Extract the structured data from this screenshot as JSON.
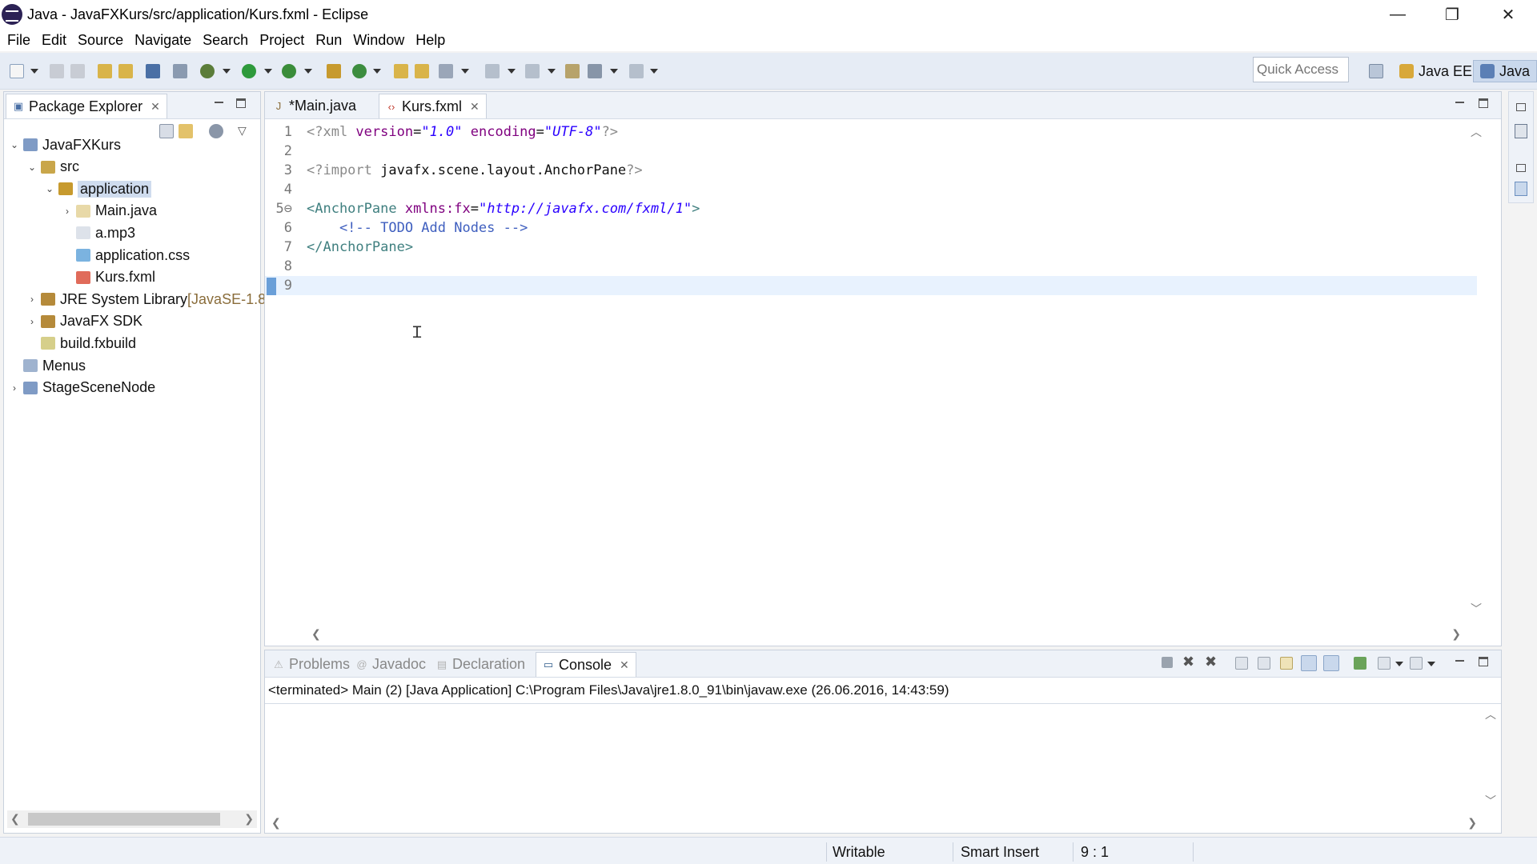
{
  "window": {
    "title": "Java - JavaFXKurs/src/application/Kurs.fxml - Eclipse",
    "minimize": "—",
    "restore": "❐",
    "close": "✕"
  },
  "menu": [
    "File",
    "Edit",
    "Source",
    "Navigate",
    "Search",
    "Project",
    "Run",
    "Window",
    "Help"
  ],
  "toolbar": {
    "quick_access_placeholder": "Quick Access",
    "perspectives": [
      "Java EE",
      "Java"
    ]
  },
  "package_explorer": {
    "title": "Package Explorer",
    "tree": [
      {
        "label": "JavaFXKurs",
        "depth": 0,
        "arrow": "open",
        "icon": "project-icon"
      },
      {
        "label": "src",
        "depth": 1,
        "arrow": "open",
        "icon": "source-folder-icon"
      },
      {
        "label": "application",
        "depth": 2,
        "arrow": "open",
        "icon": "package-icon",
        "selected": true
      },
      {
        "label": "Main.java",
        "depth": 3,
        "arrow": "closed",
        "icon": "java-file-icon"
      },
      {
        "label": "a.mp3",
        "depth": 3,
        "arrow": "none",
        "icon": "file-icon"
      },
      {
        "label": "application.css",
        "depth": 3,
        "arrow": "none",
        "icon": "css-file-icon"
      },
      {
        "label": "Kurs.fxml",
        "depth": 3,
        "arrow": "none",
        "icon": "fxml-file-icon"
      },
      {
        "label": "JRE System Library",
        "suffix": " [JavaSE-1.8",
        "depth": 1,
        "arrow": "closed",
        "icon": "library-icon"
      },
      {
        "label": "JavaFX SDK",
        "depth": 1,
        "arrow": "closed",
        "icon": "library-icon"
      },
      {
        "label": "build.fxbuild",
        "depth": 1,
        "arrow": "none",
        "icon": "build-file-icon"
      },
      {
        "label": "Menus",
        "depth": 0,
        "arrow": "none",
        "icon": "folder-icon"
      },
      {
        "label": "StageSceneNode",
        "depth": 0,
        "arrow": "closed",
        "icon": "project-icon"
      }
    ]
  },
  "editor": {
    "tabs": [
      {
        "label": "*Main.java",
        "active": false
      },
      {
        "label": "Kurs.fxml",
        "active": true
      }
    ],
    "lines": [
      {
        "n": "1",
        "parts": [
          [
            "pi",
            "<?xml "
          ],
          [
            "attr",
            "version"
          ],
          [
            "text",
            "="
          ],
          [
            "val",
            "\"1.0\""
          ],
          [
            "text",
            " "
          ],
          [
            "attr",
            "encoding"
          ],
          [
            "text",
            "="
          ],
          [
            "val",
            "\"UTF-8\""
          ],
          [
            "pi",
            "?>"
          ]
        ]
      },
      {
        "n": "2",
        "parts": []
      },
      {
        "n": "3",
        "parts": [
          [
            "pi",
            "<?import "
          ],
          [
            "text",
            "javafx.scene.layout.AnchorPane"
          ],
          [
            "pi",
            "?>"
          ]
        ]
      },
      {
        "n": "4",
        "parts": []
      },
      {
        "n": "5⊖",
        "parts": [
          [
            "tag",
            "<AnchorPane "
          ],
          [
            "attr",
            "xmlns:fx"
          ],
          [
            "text",
            "="
          ],
          [
            "val",
            "\"http://javafx.com/fxml/1\""
          ],
          [
            "tag",
            ">"
          ]
        ]
      },
      {
        "n": "6",
        "parts": [
          [
            "comment",
            "    <!-- TODO Add Nodes -->"
          ]
        ]
      },
      {
        "n": "7",
        "parts": [
          [
            "tag",
            "</AnchorPane>"
          ]
        ]
      },
      {
        "n": "8",
        "parts": []
      },
      {
        "n": "9",
        "parts": [],
        "current": true
      }
    ]
  },
  "bottom": {
    "tabs": [
      {
        "label": "Problems",
        "active": false,
        "icon": "problems-icon"
      },
      {
        "label": "Javadoc",
        "active": false,
        "icon": "javadoc-icon"
      },
      {
        "label": "Declaration",
        "active": false,
        "icon": "declaration-icon"
      },
      {
        "label": "Console",
        "active": true,
        "icon": "console-icon"
      }
    ],
    "console_header": "<terminated> Main (2) [Java Application] C:\\Program Files\\Java\\jre1.8.0_91\\bin\\javaw.exe (26.06.2016, 14:43:59)"
  },
  "status": {
    "writable": "Writable",
    "insert_mode": "Smart Insert",
    "position": "9 : 1"
  }
}
